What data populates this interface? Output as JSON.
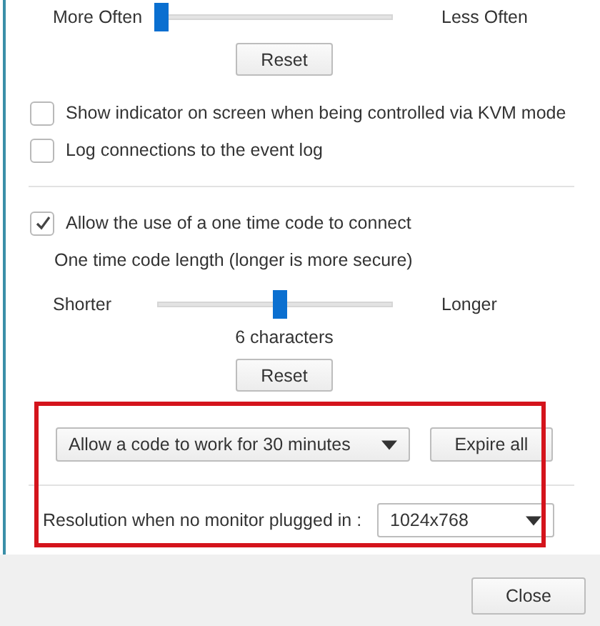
{
  "frequency": {
    "min_label": "More Often",
    "max_label": "Less Often",
    "level": 0,
    "reset": "Reset"
  },
  "options": [
    {
      "label": "Show indicator on screen when being controlled via KVM mode",
      "checked": false
    },
    {
      "label": "Log connections to the event log",
      "checked": false
    }
  ],
  "one_time_code": {
    "checkbox": {
      "label": "Allow the use of a one time code to connect",
      "checked": true
    },
    "length_label": "One time code length (longer is more secure)",
    "slider": {
      "min_label": "Shorter",
      "max_label": "Longer",
      "level": 0.5
    },
    "reading": "6 characters",
    "reset": "Reset",
    "duration": {
      "value": "Allow a code to work for 30 minutes"
    },
    "expire_button": "Expire all"
  },
  "resolution": {
    "label": "Resolution when no monitor plugged in :",
    "value": "1024x768"
  },
  "footer": {
    "close_button": "Close"
  }
}
